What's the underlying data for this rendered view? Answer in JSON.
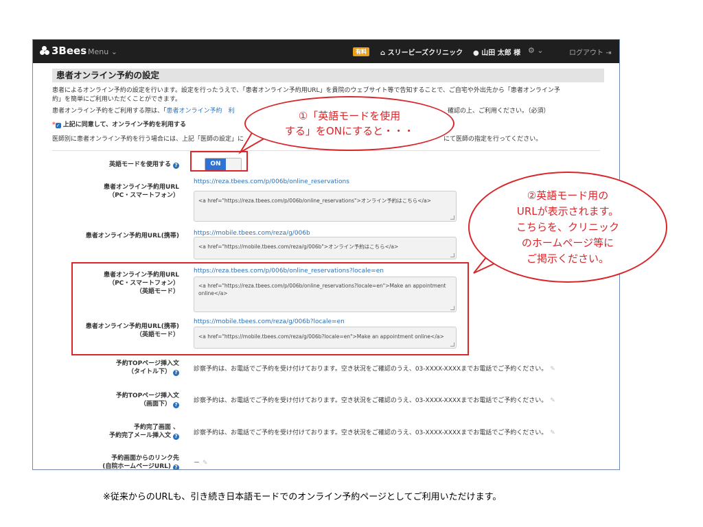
{
  "nav": {
    "brand": "3Bees",
    "menu_label": "Menu",
    "plan_badge": "有料",
    "clinic_name": "スリービーズクリニック",
    "user_name": "山田 太郎 様",
    "logout_label": "ログアウト"
  },
  "page": {
    "title": "患者オンライン予約の設定",
    "intro_line1": "患者によるオンライン予約の設定を行います。設定を行ったうえで、「患者オンライン予約用URL」を貴院のウェブサイト等で告知することで、ご自宅や外出先から「患者オンライン予",
    "intro_line2": "約」を簡単にご利用いただくことができます。",
    "policy_text_before": "患者オンライン予約をご利用する際は、「",
    "policy_link": "患者オンライン予約　利",
    "policy_text_after": "確認の上、ご利用ください。（必須）",
    "required_mark": "*",
    "agree_label": "上記に同意して、オンライン予約を利用する",
    "doctor_text_before": "医師別に患者オンライン予約を行う場合には、上記「医師の設定」に",
    "doctor_text_after": "にて医師の指定を行ってください。"
  },
  "settings": {
    "english_mode_label": "英語モードを使用する",
    "toggle_value": "ON",
    "pc_url_label_1": "患者オンライン予約用URL",
    "pc_url_label_2": "（PC・スマートフォン）",
    "pc_url": "https://reza.tbees.com/p/006b/online_reservations",
    "pc_code": "<a href=\"https://reza.tbees.com/p/006b/online_reservations\">オンライン予約はこちら</a>",
    "mobile_url_label": "患者オンライン予約用URL(携帯)",
    "mobile_url": "https://mobile.tbees.com/reza/g/006b",
    "mobile_code": "<a href=\"https://mobile.tbees.com/reza/g/006b\">オンライン予約はこちら</a>",
    "pc_en_label_1": "患者オンライン予約用URL",
    "pc_en_label_2": "（PC・スマートフォン）",
    "pc_en_label_3": "（英語モード）",
    "pc_en_url": "https://reza.tbees.com/p/006b/online_reservations?locale=en",
    "pc_en_code": "<a href=\"https://reza.tbees.com/p/006b/online_reservations?locale=en\">Make an appointment online</a>",
    "mobile_en_label_1": "患者オンライン予約用URL(携帯)",
    "mobile_en_label_2": "（英語モード）",
    "mobile_en_url": "https://mobile.tbees.com/reza/g/006b?locale=en",
    "mobile_en_code": "<a href=\"https://mobile.tbees.com/reza/g/006b?locale=en\">Make an appointment online</a>",
    "top_title_label_1": "予約TOPページ挿入文",
    "top_title_label_2": "（タイトル下）",
    "top_bottom_label_1": "予約TOPページ挿入文",
    "top_bottom_label_2": "（画面下）",
    "done_label_1": "予約完了画面 、",
    "done_label_2": "予約完了メール挿入文",
    "insert_text": "診察予約は、お電話でご予約を受け付けております。空き状況をご確認のうえ、03-XXXX-XXXXまでお電話でご予約ください。",
    "link_label_1": "予約画面からのリンク先",
    "link_label_2": "(自院ホームページURL)",
    "link_value": "－"
  },
  "callouts": {
    "one_line1": "①「英語モードを使用",
    "one_line2": "する」をONにすると・・・",
    "two_line1": "②英語モード用の",
    "two_line2": "URLが表示されます。",
    "two_line3": "こちらを、クリニック",
    "two_line4": "のホームページ等に",
    "two_line5": "ご掲示ください。"
  },
  "footnote": "※従来からのURLも、引き続き日本語モードでのオンライン予約ページとしてご利用いただけます。",
  "colors": {
    "accent_red": "#d8262b",
    "link_blue": "#2a6fb8",
    "toggle_blue": "#2f72d6",
    "nav_dark": "#1f1f1f"
  }
}
